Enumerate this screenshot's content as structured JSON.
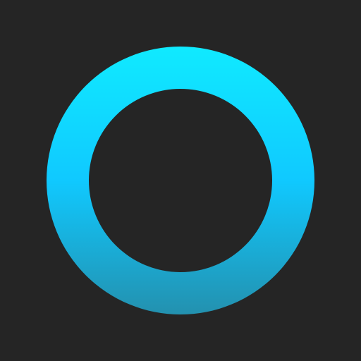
{
  "icon": {
    "name": "ring-icon",
    "background_color": "#252525",
    "gradient": {
      "top_color": "#10EAFF",
      "middle_color": "#10C9FF",
      "bottom_color": "#2391AF"
    }
  }
}
